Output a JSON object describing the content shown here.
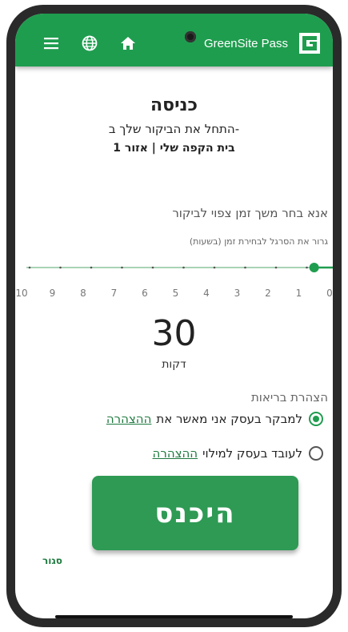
{
  "appbar": {
    "brand": "GreenSite Pass",
    "icons": [
      "menu-icon",
      "globe-icon",
      "home-icon",
      "logo-icon"
    ],
    "color": "#1f9d4f"
  },
  "header": {
    "title": "כניסה",
    "subtitle": "התחל את הביקור שלך ב-",
    "location": "בית הקפה שלי | אזור 1"
  },
  "duration": {
    "question_prefix": "אנא",
    "question": "בחר משך זמן צפוי לביקור",
    "hint": "גרור את הסרגל לבחירת זמן (בשעות)",
    "scale": [
      "10",
      "9",
      "8",
      "7",
      "6",
      "5",
      "4",
      "3",
      "2",
      "1",
      "0"
    ],
    "slider_value_hours": 0.5,
    "value": "30",
    "unit": "דקות"
  },
  "health": {
    "title": "הצהרת בריאות",
    "visitor_label": "למבקר בעסק אני מאשר את",
    "visitor_link": "ההצהרה",
    "worker_label": "לעובד בעסק למילוי",
    "worker_link": "ההצהרה",
    "selected": "visitor"
  },
  "actions": {
    "enter_label": "היכנס",
    "close_label": "סגור"
  }
}
